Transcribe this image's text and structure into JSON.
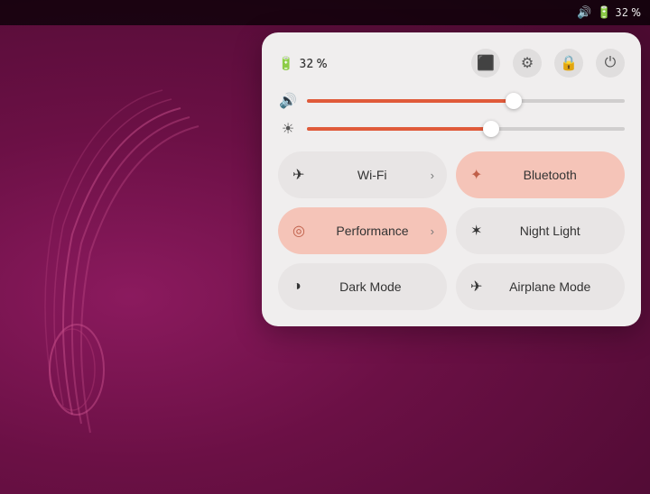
{
  "desktop": {
    "bg_color": "#6b1045"
  },
  "topbar": {
    "sound_icon": "🔊",
    "battery_icon": "🔋",
    "battery_label": "32 %"
  },
  "panel": {
    "battery_icon": "🔋",
    "battery_label": "32 %",
    "screenshot_icon": "⬜",
    "settings_icon": "⚙",
    "lock_icon": "🔒",
    "power_icon": "⏻",
    "volume_icon": "🔊",
    "volume_pct": 65,
    "brightness_icon": "☀",
    "brightness_pct": 58,
    "buttons": [
      {
        "id": "wifi",
        "label": "Wi-Fi",
        "icon": "✈",
        "active": false,
        "has_chevron": true
      },
      {
        "id": "bluetooth",
        "label": "Bluetooth",
        "icon": "✦",
        "active": true,
        "has_chevron": false
      },
      {
        "id": "performance",
        "label": "Performance",
        "icon": "◎",
        "active": true,
        "has_chevron": true
      },
      {
        "id": "night-light",
        "label": "Night Light",
        "icon": "✶",
        "active": false,
        "has_chevron": false
      },
      {
        "id": "dark-mode",
        "label": "Dark Mode",
        "icon": "◑",
        "active": false,
        "has_chevron": false
      },
      {
        "id": "airplane-mode",
        "label": "Airplane Mode",
        "icon": "✈",
        "active": false,
        "has_chevron": false
      }
    ]
  }
}
